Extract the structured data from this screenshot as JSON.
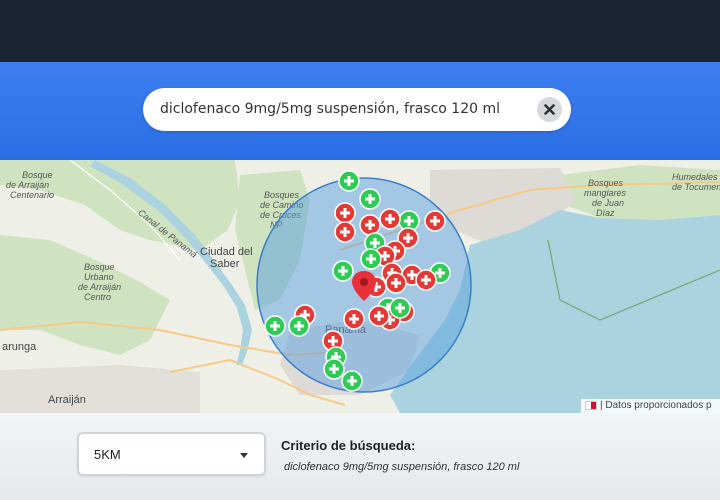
{
  "search": {
    "query": "diclofenaco 9mg/5mg suspensión, frasco 120 ml",
    "clear_icon": "close-icon"
  },
  "map": {
    "labels": {
      "bosque_arraijan": "Bosque\nde Arraiján\nCentenario",
      "bosques_camino": "Bosques\nde Camino\nde Cruces\nNP",
      "ciudad_saber": "Ciudad del\nSaber",
      "bosque_urbano": "Bosque\nUrbano\nde Arraiján\nCentro",
      "bosques_manglares": "Bosques\nmanglares\nde Juan\nDíaz",
      "humedales": "Humedales\nde Tocumen",
      "panama": "Panamá",
      "arraijan": "Arraiján",
      "carunga": "arunga",
      "canal": "Canal de Panamá"
    },
    "marker_colors": {
      "available": "#2ecc55",
      "unavailable": "#e53935"
    },
    "selected_pin_color": "#e8303a",
    "radius_fill": "#5a9fe0",
    "attribution": "| Datos proporcionados p"
  },
  "filter": {
    "radius_value": "5KM",
    "criteria_label": "Criterio de búsqueda:",
    "criteria_value": "diclofenaco 9mg/5mg suspensión, frasco 120 ml"
  }
}
